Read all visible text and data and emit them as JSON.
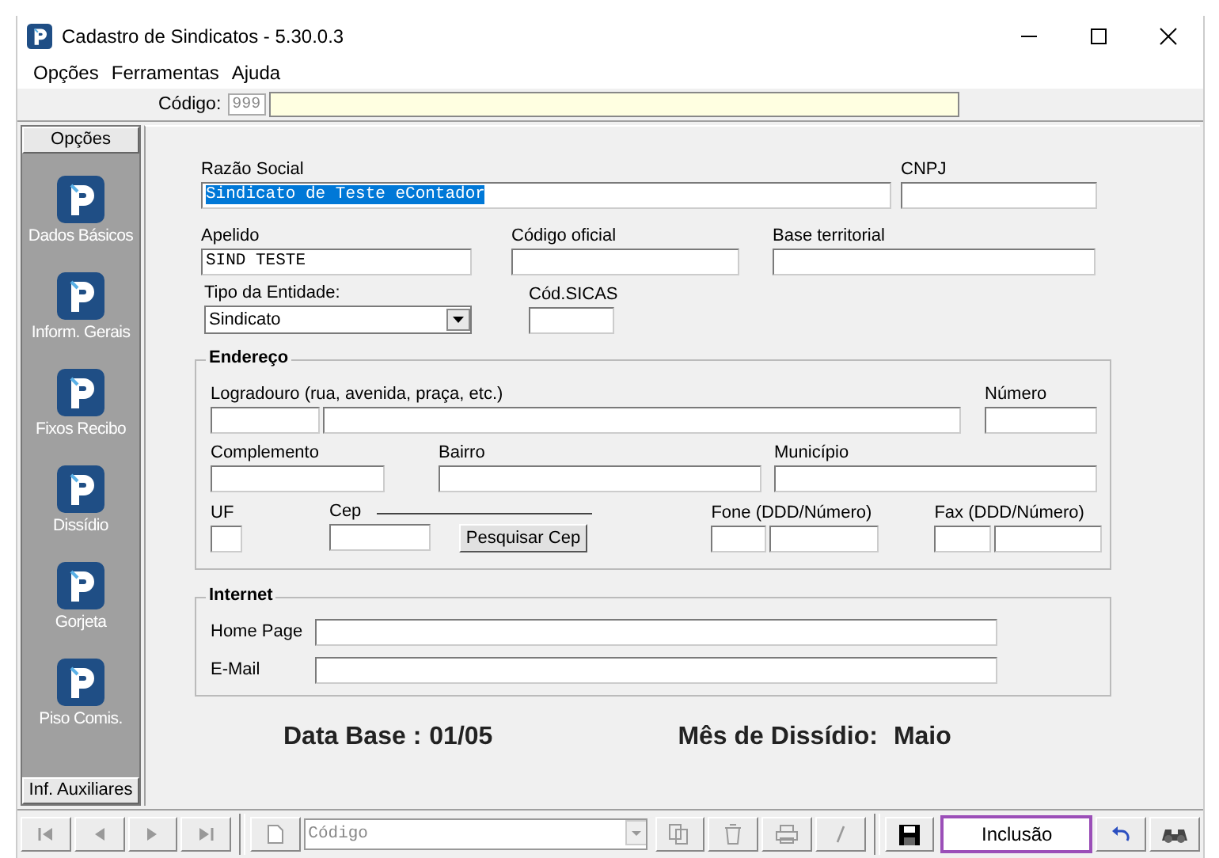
{
  "window": {
    "title": "Cadastro de Sindicatos - 5.30.0.3"
  },
  "menu": [
    {
      "label": "Opções"
    },
    {
      "label": "Ferramentas"
    },
    {
      "label": "Ajuda"
    }
  ],
  "code_bar": {
    "label": "Código:",
    "prefix": "999"
  },
  "sidebar": {
    "header": "Opções",
    "footer": "Inf. Auxiliares",
    "items": [
      {
        "label": "Dados Básicos"
      },
      {
        "label": "Inform. Gerais"
      },
      {
        "label": "Fixos Recibo"
      },
      {
        "label": "Dissídio"
      },
      {
        "label": "Gorjeta"
      },
      {
        "label": "Piso Comis."
      }
    ]
  },
  "form": {
    "fields": [
      {
        "label": "Razão Social",
        "value": "Sindicato de Teste eContador",
        "text_selected": true
      },
      {
        "label": "CNPJ"
      },
      {
        "label": "Apelido",
        "value": "SIND TESTE",
        "text_selected": false
      },
      {
        "label": "Código oficial"
      },
      {
        "label": "Base territorial"
      },
      {
        "label": "Tipo da Entidade:",
        "value": "Sindicato",
        "kind": "dropdown"
      },
      {
        "label": "Cód.SICAS"
      }
    ]
  },
  "address": {
    "title": "Endereço",
    "fields": [
      {
        "label": "Logradouro (rua, avenida, praça, etc.)"
      },
      {
        "label": "Número"
      },
      {
        "label": "Complemento"
      },
      {
        "label": "Bairro"
      },
      {
        "label": "Município"
      },
      {
        "label": "UF"
      },
      {
        "label": "Cep"
      },
      {
        "label": "Fone (DDD/Número)"
      },
      {
        "label": "Fax (DDD/Número)"
      }
    ],
    "search_button": "Pesquisar Cep"
  },
  "internet": {
    "title": "Internet",
    "fields": [
      {
        "label": "Home Page"
      },
      {
        "label": "E-Mail"
      }
    ]
  },
  "info": [
    {
      "label": "Data Base :",
      "value": "01/05"
    },
    {
      "label": "Mês de Dissídio:",
      "value": "Maio"
    }
  ],
  "toolbar": {
    "search_placeholder": "Código",
    "mode": "Inclusão"
  }
}
